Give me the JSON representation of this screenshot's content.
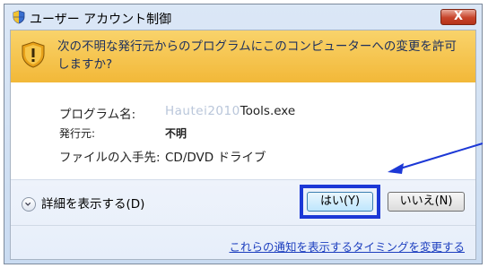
{
  "window": {
    "title": "ユーザー アカウント制御",
    "close_label": "X"
  },
  "banner": {
    "message": "次の不明な発行元からのプログラムにこのコンピューターへの変更を許可しますか?"
  },
  "info": {
    "program_label": "プログラム名:",
    "program_value_blurred": "Hautei2010",
    "program_value": "Tools.exe",
    "publisher_label": "発行元:",
    "publisher_value": "不明",
    "origin_label": "ファイルの入手先:",
    "origin_value": "CD/DVD ドライブ"
  },
  "footer": {
    "details_label": "詳細を表示する(D)",
    "yes_label": "はい(Y)",
    "no_label": "いいえ(N)",
    "notify_link": "これらの通知を表示するタイミングを変更する"
  },
  "colors": {
    "banner": "#f2b838",
    "highlight_box": "#1c38d6",
    "link": "#1d3fbf"
  }
}
